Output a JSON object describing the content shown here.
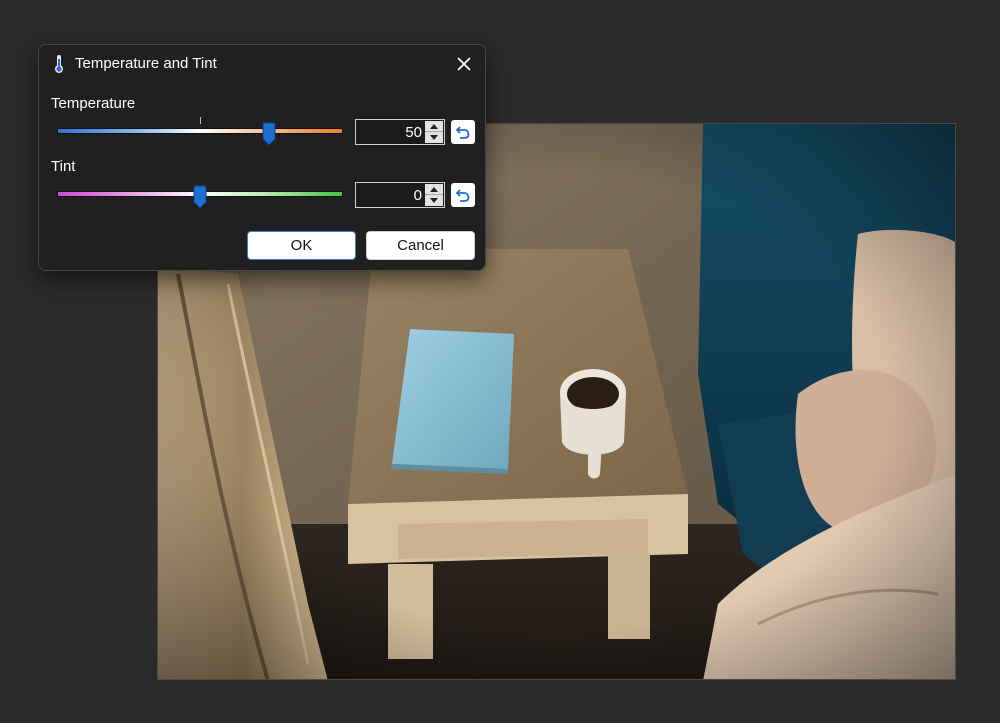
{
  "dialog": {
    "title": "Temperature and Tint",
    "title_icon": "thermometer-icon",
    "close_icon": "close-icon",
    "temperature": {
      "label": "Temperature",
      "value": "50",
      "slider_fraction": 0.74,
      "gradient": [
        "#2f6fd6",
        "#ffffff",
        "#ee7c2a"
      ]
    },
    "tint": {
      "label": "Tint",
      "value": "0",
      "slider_fraction": 0.5,
      "gradient": [
        "#d247d2",
        "#ffffff",
        "#45c24a"
      ]
    },
    "reset_icon": "undo-icon",
    "ok_label": "OK",
    "cancel_label": "Cancel"
  },
  "colors": {
    "accent": "#1f6fd1",
    "background": "#2b2b2b",
    "dialog_bg": "#202020"
  }
}
